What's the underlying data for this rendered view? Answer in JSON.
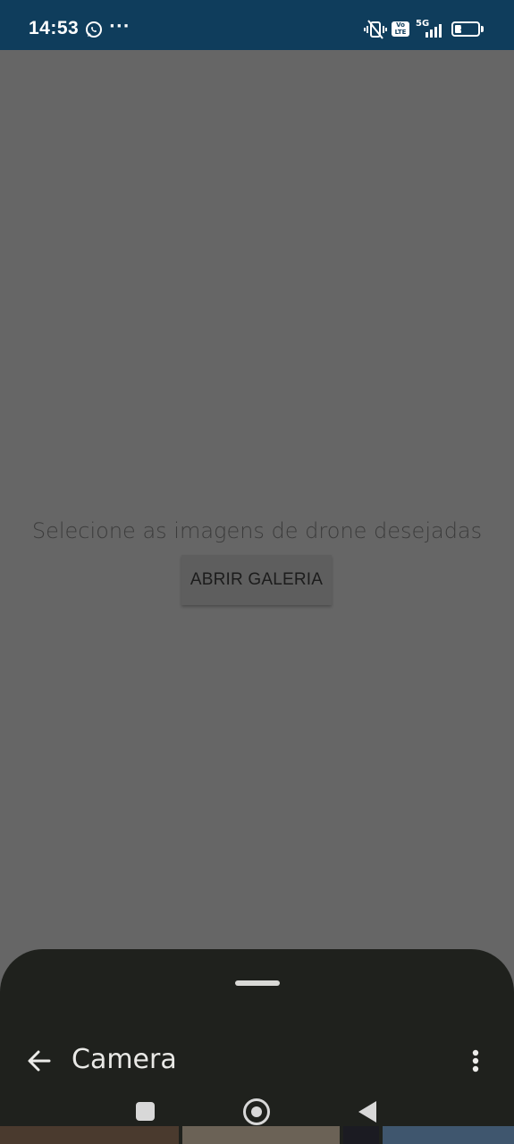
{
  "status_bar": {
    "time": "14:53",
    "more": "···",
    "network": "5G",
    "volte": "Vo LTE",
    "battery": "31",
    "battery_percent": 31
  },
  "icons": {
    "whatsapp": "whatsapp-icon",
    "mute": "vibrate-off-icon",
    "signal": "signal-icon",
    "back": "arrow-left-icon",
    "overflow": "more-vert-icon",
    "recents": "square-icon",
    "home": "circle-icon",
    "nav_back": "triangle-left-icon"
  },
  "main": {
    "prompt": "Selecione as imagens de drone desejadas",
    "button_label": "ABRIR GALERIA"
  },
  "sheet": {
    "title": "Camera"
  },
  "colors": {
    "status_bar": "#0f3d5c",
    "scrim": "#666666",
    "sheet": "#1f211d"
  }
}
